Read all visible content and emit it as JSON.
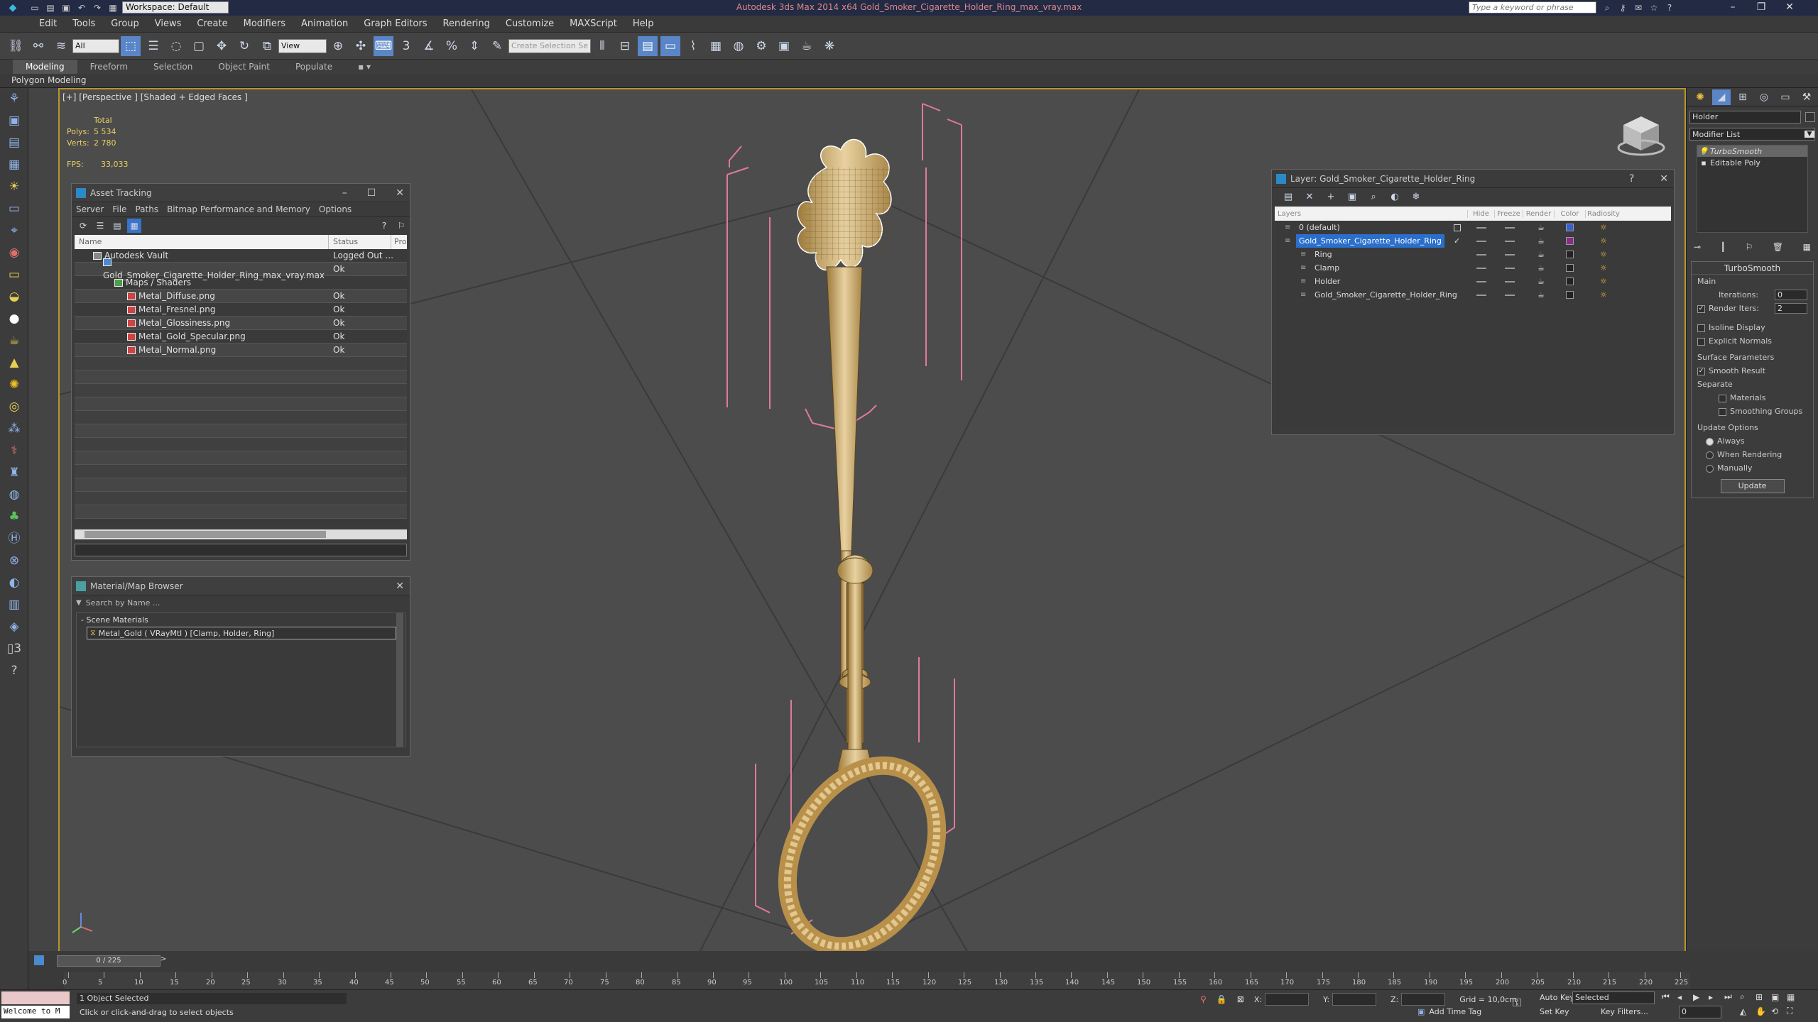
{
  "titlebar": {
    "workspace": "Workspace: Default",
    "title": "Autodesk 3ds Max  2014 x64    Gold_Smoker_Cigarette_Holder_Ring_max_vray.max",
    "search_placeholder": "Type a keyword or phrase"
  },
  "menu": [
    "Edit",
    "Tools",
    "Group",
    "Views",
    "Create",
    "Modifiers",
    "Animation",
    "Graph Editors",
    "Rendering",
    "Customize",
    "MAXScript",
    "Help"
  ],
  "toolbar": {
    "filter": "All",
    "refcoord": "View",
    "selection_set": "Create Selection Se"
  },
  "ribbon": {
    "tabs": [
      "Modeling",
      "Freeform",
      "Selection",
      "Object Paint",
      "Populate"
    ],
    "sub": "Polygon Modeling"
  },
  "viewport": {
    "label": "[+] [Perspective ] [Shaded + Edged Faces ]",
    "stats": {
      "total_label": "Total",
      "polys_label": "Polys:",
      "polys": "5 534",
      "verts_label": "Verts:",
      "verts": "2 780",
      "fps_label": "FPS:",
      "fps": "33,033"
    }
  },
  "asset_tracking": {
    "title": "Asset Tracking",
    "menu": [
      "Server",
      "File",
      "Paths",
      "Bitmap Performance and Memory",
      "Options"
    ],
    "columns": [
      "Name",
      "Status",
      "Pro"
    ],
    "rows": [
      {
        "name": "Autodesk Vault",
        "status": "Logged Out ..."
      },
      {
        "name": "Gold_Smoker_Cigarette_Holder_Ring_max_vray.max",
        "status": "Ok"
      },
      {
        "name": "Maps / Shaders",
        "status": ""
      },
      {
        "name": "Metal_Diffuse.png",
        "status": "Ok"
      },
      {
        "name": "Metal_Fresnel.png",
        "status": "Ok"
      },
      {
        "name": "Metal_Glossiness.png",
        "status": "Ok"
      },
      {
        "name": "Metal_Gold_Specular.png",
        "status": "Ok"
      },
      {
        "name": "Metal_Normal.png",
        "status": "Ok"
      }
    ]
  },
  "material_browser": {
    "title": "Material/Map Browser",
    "search_placeholder": "Search by Name ...",
    "group": "- Scene Materials",
    "item": "Metal_Gold  ( VRayMtl ) [Clamp, Holder, Ring]"
  },
  "layer_manager": {
    "title": "Layer: Gold_Smoker_Cigarette_Holder_Ring",
    "columns": [
      "Layers",
      "Hide",
      "Freeze",
      "Render",
      "Color",
      "Radiosity"
    ],
    "rows": [
      {
        "name": "0 (default)",
        "color": "#3a5fd0",
        "selected": false,
        "indent": 0
      },
      {
        "name": "Gold_Smoker_Cigarette_Holder_Ring",
        "color": "#8a2a8a",
        "selected": true,
        "indent": 0
      },
      {
        "name": "Ring",
        "color": "#222222",
        "selected": false,
        "indent": 1
      },
      {
        "name": "Clamp",
        "color": "#222222",
        "selected": false,
        "indent": 1
      },
      {
        "name": "Holder",
        "color": "#222222",
        "selected": false,
        "indent": 1
      },
      {
        "name": "Gold_Smoker_Cigarette_Holder_Ring",
        "color": "#222222",
        "selected": false,
        "indent": 1
      }
    ]
  },
  "command_panel": {
    "object_name": "Holder",
    "modifier_list": "Modifier List",
    "stack": [
      "TurboSmooth",
      "Editable Poly"
    ],
    "rollout_title": "TurboSmooth",
    "main": "Main",
    "iterations_label": "Iterations:",
    "iterations": "0",
    "render_iters_label": "Render Iters:",
    "render_iters": "2",
    "isoline": "Isoline Display",
    "explicit": "Explicit Normals",
    "surface": "Surface Parameters",
    "smooth_result": "Smooth Result",
    "separate": "Separate",
    "materials": "Materials",
    "smoothing_groups": "Smoothing Groups",
    "update_options": "Update Options",
    "always": "Always",
    "when_rendering": "When Rendering",
    "manually": "Manually",
    "update_btn": "Update"
  },
  "timeline": {
    "frame": "0 / 225",
    "ticks": [
      "0",
      "5",
      "10",
      "15",
      "20",
      "25",
      "30",
      "35",
      "40",
      "45",
      "50",
      "55",
      "60",
      "65",
      "70",
      "75",
      "80",
      "85",
      "90",
      "95",
      "100",
      "105",
      "110",
      "115",
      "120",
      "125",
      "130",
      "135",
      "140",
      "145",
      "150",
      "155",
      "160",
      "165",
      "170",
      "175",
      "180",
      "185",
      "190",
      "195",
      "200",
      "205",
      "210",
      "215",
      "220",
      "225"
    ]
  },
  "status": {
    "script": "Welcome to M",
    "selected": "1 Object Selected",
    "hint": "Click or click-and-drag to select objects",
    "x_label": "X:",
    "y_label": "Y:",
    "z_label": "Z:",
    "grid": "Grid = 10,0cm",
    "add_time_tag": "Add Time Tag",
    "auto_key": "Auto Key",
    "set_key": "Set Key",
    "selected_dd": "Selected",
    "key_filters": "Key Filters...",
    "frame_field": "0"
  }
}
